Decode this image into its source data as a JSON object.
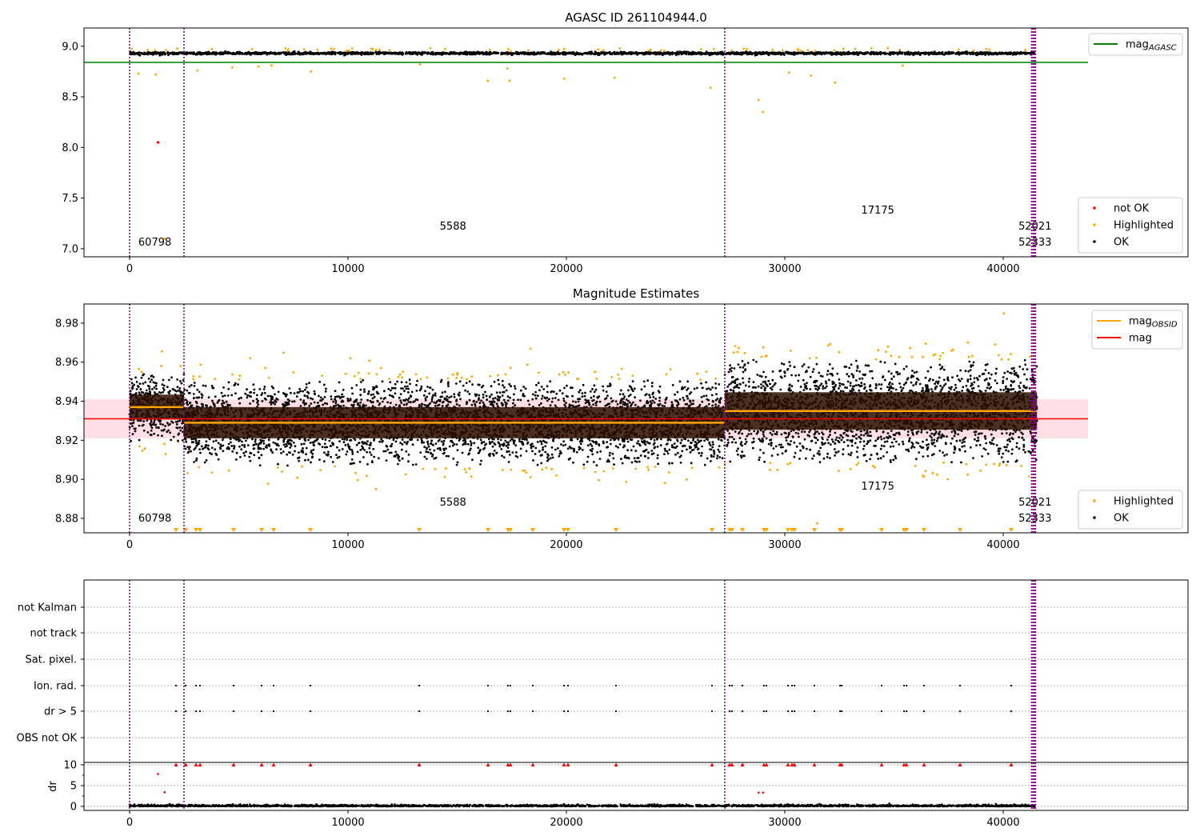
{
  "chart_data": [
    {
      "type": "scatter",
      "title": "AGASC ID 261104944.0",
      "xlim": [
        -2088,
        48460
      ],
      "ylim": [
        6.92,
        9.18
      ],
      "xticks": [
        "0",
        "10000",
        "20000",
        "30000",
        "40000"
      ],
      "xtick_values": [
        0,
        10000,
        20000,
        30000,
        40000
      ],
      "yticks": [
        "7.0",
        "7.5",
        "8.0",
        "8.5",
        "9.0"
      ],
      "ytick_values": [
        7.0,
        7.5,
        8.0,
        8.5,
        9.0
      ],
      "mag_agasc": 8.84,
      "ok_mean": 8.93,
      "ok_std": 0.006,
      "not_ok_points": [
        [
          1300,
          8.05
        ]
      ],
      "highlighted_points": [
        [
          400,
          8.73
        ],
        [
          1200,
          8.72
        ],
        [
          1600,
          7.1
        ],
        [
          3100,
          8.76
        ],
        [
          4700,
          8.79
        ],
        [
          5900,
          8.8
        ],
        [
          6500,
          8.81
        ],
        [
          8300,
          8.75
        ],
        [
          13300,
          8.82
        ],
        [
          16400,
          8.66
        ],
        [
          17300,
          8.78
        ],
        [
          17400,
          8.66
        ],
        [
          19900,
          8.68
        ],
        [
          22200,
          8.69
        ],
        [
          26600,
          8.59
        ],
        [
          28800,
          8.47
        ],
        [
          29000,
          8.35
        ],
        [
          30200,
          8.74
        ],
        [
          31200,
          8.71
        ],
        [
          32300,
          8.64
        ],
        [
          35400,
          8.81
        ]
      ],
      "legend_upper": [
        {
          "label": "mag",
          "sub": "AGASC",
          "color": "#008000"
        }
      ],
      "legend_lower": [
        {
          "label": "not OK",
          "color": "#ff0000"
        },
        {
          "label": "Highlighted",
          "color": "#ffa500"
        },
        {
          "label": "OK",
          "color": "#000000"
        }
      ],
      "legend_position": "upper-right / lower-right"
    },
    {
      "type": "scatter",
      "title": "Magnitude Estimates",
      "xlim": [
        -2088,
        48460
      ],
      "ylim": [
        8.8726,
        8.9898
      ],
      "xticks": [
        "0",
        "10000",
        "20000",
        "30000",
        "40000"
      ],
      "xtick_values": [
        0,
        10000,
        20000,
        30000,
        40000
      ],
      "yticks": [
        "8.88",
        "8.90",
        "8.92",
        "8.94",
        "8.96",
        "8.98"
      ],
      "ytick_values": [
        8.88,
        8.9,
        8.92,
        8.94,
        8.96,
        8.98
      ],
      "mag": 8.931,
      "mag_band": [
        8.921,
        8.941
      ],
      "obsid_segments": [
        {
          "x0": 0,
          "x1": 2490,
          "mag_obsid": 8.937,
          "std": 0.008
        },
        {
          "x0": 2490,
          "x1": 27250,
          "mag_obsid": 8.929,
          "std": 0.01
        },
        {
          "x0": 27250,
          "x1": 41550,
          "mag_obsid": 8.935,
          "std": 0.012
        }
      ],
      "legend_upper": [
        {
          "label": "mag",
          "sub": "OBSID",
          "color": "#ffa500"
        },
        {
          "label": "mag",
          "sub": "",
          "color": "#ff0000"
        }
      ],
      "legend_lower": [
        {
          "label": "Highlighted",
          "color": "#ffa500"
        },
        {
          "label": "OK",
          "color": "#000000"
        }
      ]
    },
    {
      "type": "scatter",
      "xlim": [
        -2088,
        48460
      ],
      "categories": [
        "not Kalman",
        "not track",
        "Sat. pixel.",
        "Ion. rad.",
        "dr > 5",
        "OBS not OK"
      ],
      "flag_x": [
        2125,
        2564,
        3040,
        3223,
        4762,
        6044,
        6593,
        8278,
        13260,
        16410,
        17326,
        17436,
        18462,
        19890,
        20073,
        22271,
        26667,
        27473,
        27582,
        28059,
        29048,
        29158,
        30147,
        30330,
        30440,
        31355,
        32527,
        32601,
        34432,
        35458,
        35568,
        36374,
        38022,
        40366
      ],
      "dr_ylabel": "dr",
      "dr_yticks": [
        "0",
        "5",
        "10"
      ],
      "dr_ytick_values": [
        0,
        5,
        10
      ],
      "dr_extra_points": [
        [
          1300,
          7.8
        ],
        [
          1600,
          3.4
        ],
        [
          28800,
          3.3
        ],
        [
          29000,
          3.3
        ]
      ],
      "xticks": [
        "0",
        "10000",
        "20000",
        "30000",
        "40000"
      ],
      "xtick_values": [
        0,
        10000,
        20000,
        30000,
        40000
      ]
    }
  ],
  "obsid_boundaries": [
    0,
    2490,
    27250,
    41300,
    41360,
    41420,
    41480
  ],
  "obsid_labels": [
    {
      "text": "60798",
      "x": 400,
      "y_rank": 0
    },
    {
      "text": "5588",
      "x": 14200,
      "y_rank": 1
    },
    {
      "text": "17175",
      "x": 33500,
      "y_rank": 2
    },
    {
      "text": "52021",
      "x": 40700,
      "y_rank": 1
    },
    {
      "text": "52333",
      "x": 40700,
      "y_rank": 0
    }
  ],
  "colors": {
    "ok": "#000000",
    "highlighted": "#ffa500",
    "not_ok": "#ff0000",
    "agasc": "#008000",
    "boundary": "#800080",
    "band": "#ffc0cb"
  }
}
